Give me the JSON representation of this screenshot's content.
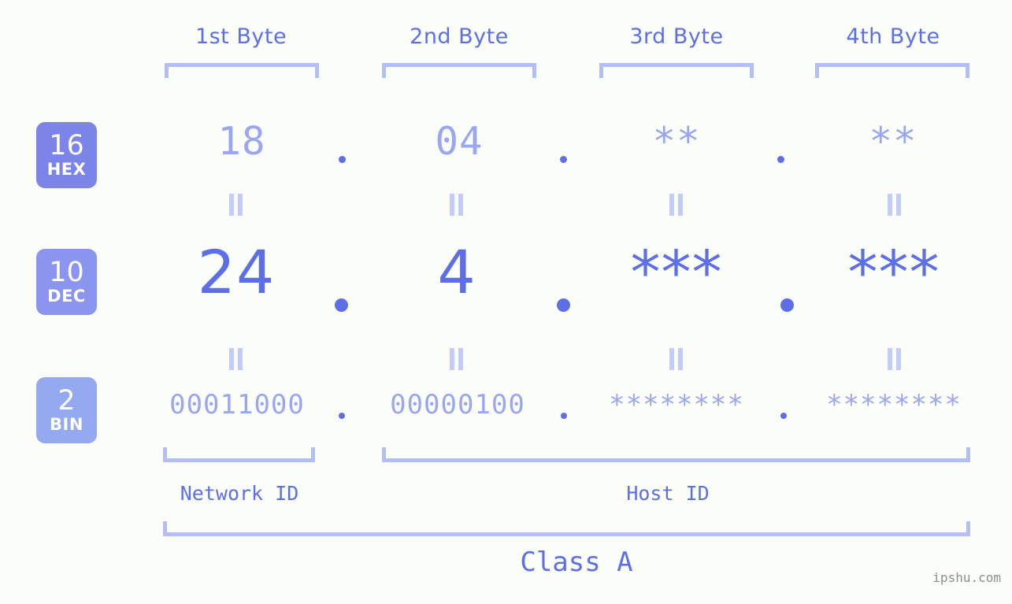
{
  "watermark": "ipshu.com",
  "colors": {
    "background": "#fbfdf8",
    "accent_strong": "#5c6fe8",
    "accent_light": "#9aa6f2",
    "bracket": "#b3bdf7",
    "equals": "#c3cbf8",
    "badge_hex": "#7b85e8",
    "badge_dec": "#8995ee",
    "badge_bin": "#94a9f0",
    "watermark_text": "#8e8e8e"
  },
  "byte_headers": [
    {
      "label": "1st Byte"
    },
    {
      "label": "2nd Byte"
    },
    {
      "label": "3rd Byte"
    },
    {
      "label": "4th Byte"
    }
  ],
  "radix_badges": [
    {
      "number": "16",
      "name": "HEX"
    },
    {
      "number": "10",
      "name": "DEC"
    },
    {
      "number": "2",
      "name": "BIN"
    }
  ],
  "rows": {
    "hex": {
      "values": [
        "18",
        "04",
        "**",
        "**"
      ],
      "separator": "."
    },
    "dec": {
      "values": [
        "24",
        "4",
        "***",
        "***"
      ],
      "separator": "."
    },
    "bin": {
      "values": [
        "00011000",
        "00000100",
        "********",
        "********"
      ],
      "separator": "."
    }
  },
  "equals_symbol": "=",
  "segments": [
    {
      "label": "Network ID"
    },
    {
      "label": "Host ID"
    }
  ],
  "class_label": "Class A"
}
